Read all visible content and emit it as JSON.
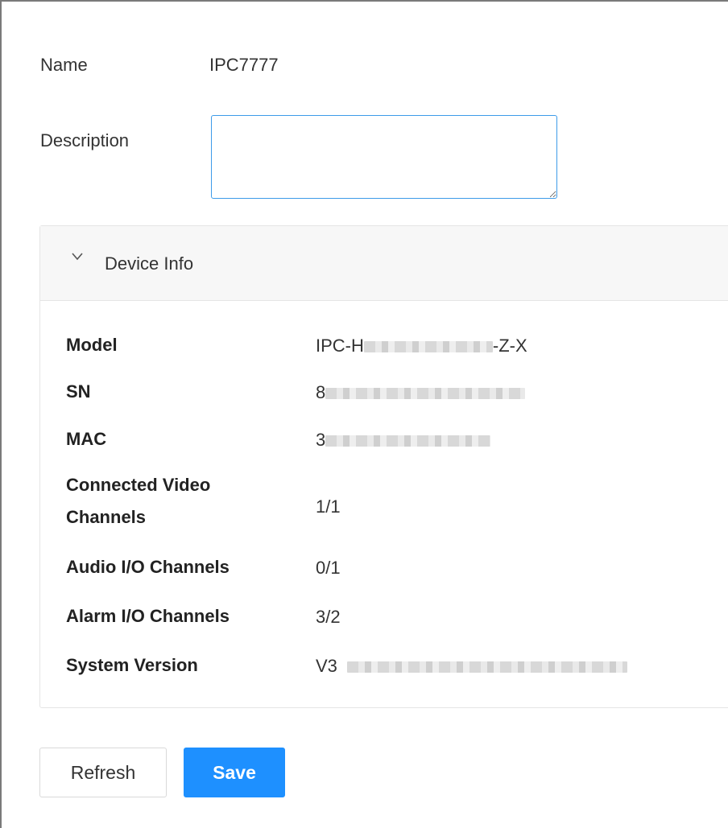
{
  "form": {
    "name_label": "Name",
    "name_value": "IPC7777",
    "description_label": "Description",
    "description_value": ""
  },
  "device_info": {
    "title": "Device Info",
    "expanded": true,
    "rows": [
      {
        "label": "Model",
        "value_prefix": "IPC-H",
        "value_suffix": "-Z-X",
        "redacted": true
      },
      {
        "label": "SN",
        "value_prefix": "8",
        "value_suffix": "",
        "redacted": true
      },
      {
        "label": "MAC",
        "value_prefix": "3",
        "value_suffix": "",
        "redacted": true
      },
      {
        "label": "Connected Video Channels",
        "value_prefix": "1/1",
        "value_suffix": "",
        "redacted": false
      },
      {
        "label": "Audio I/O Channels",
        "value_prefix": "0/1",
        "value_suffix": "",
        "redacted": false
      },
      {
        "label": "Alarm I/O Channels",
        "value_prefix": "3/2",
        "value_suffix": "",
        "redacted": false
      },
      {
        "label": "System Version",
        "value_prefix": "V3",
        "value_suffix": "",
        "redacted": true
      }
    ]
  },
  "buttons": {
    "refresh_label": "Refresh",
    "save_label": "Save"
  },
  "colors": {
    "accent": "#1e90ff",
    "input_focus_border": "#3d9be9"
  }
}
